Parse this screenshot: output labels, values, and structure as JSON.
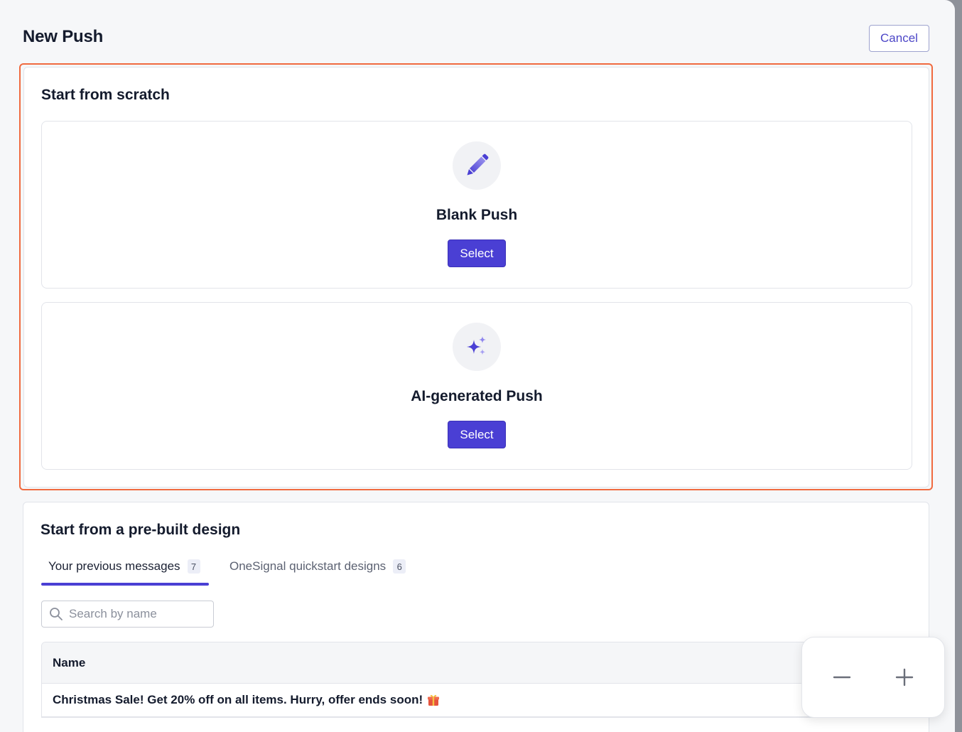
{
  "page": {
    "title": "New Push",
    "cancel_label": "Cancel"
  },
  "scratch": {
    "title": "Start from scratch",
    "options": [
      {
        "title": "Blank Push",
        "icon": "pencil-icon",
        "button": "Select"
      },
      {
        "title": "AI-generated Push",
        "icon": "sparkles-icon",
        "button": "Select"
      }
    ]
  },
  "prebuilt": {
    "title": "Start from a pre-built design",
    "tabs": [
      {
        "label": "Your previous messages",
        "count": "7",
        "active": true
      },
      {
        "label": "OneSignal quickstart designs",
        "count": "6",
        "active": false
      }
    ],
    "search": {
      "placeholder": "Search by name",
      "value": ""
    },
    "table": {
      "columns": [
        "Name"
      ],
      "rows": [
        {
          "name": "Christmas Sale! Get 20% off on all items. Hurry, offer ends soon!",
          "emoji_icon": "gift-icon"
        }
      ]
    }
  },
  "zoom": {
    "minus_icon": "minus-icon",
    "plus_icon": "plus-icon"
  },
  "colors": {
    "accent": "#4a3fd4",
    "highlight": "#f06a3f",
    "background": "#f6f7f9"
  }
}
